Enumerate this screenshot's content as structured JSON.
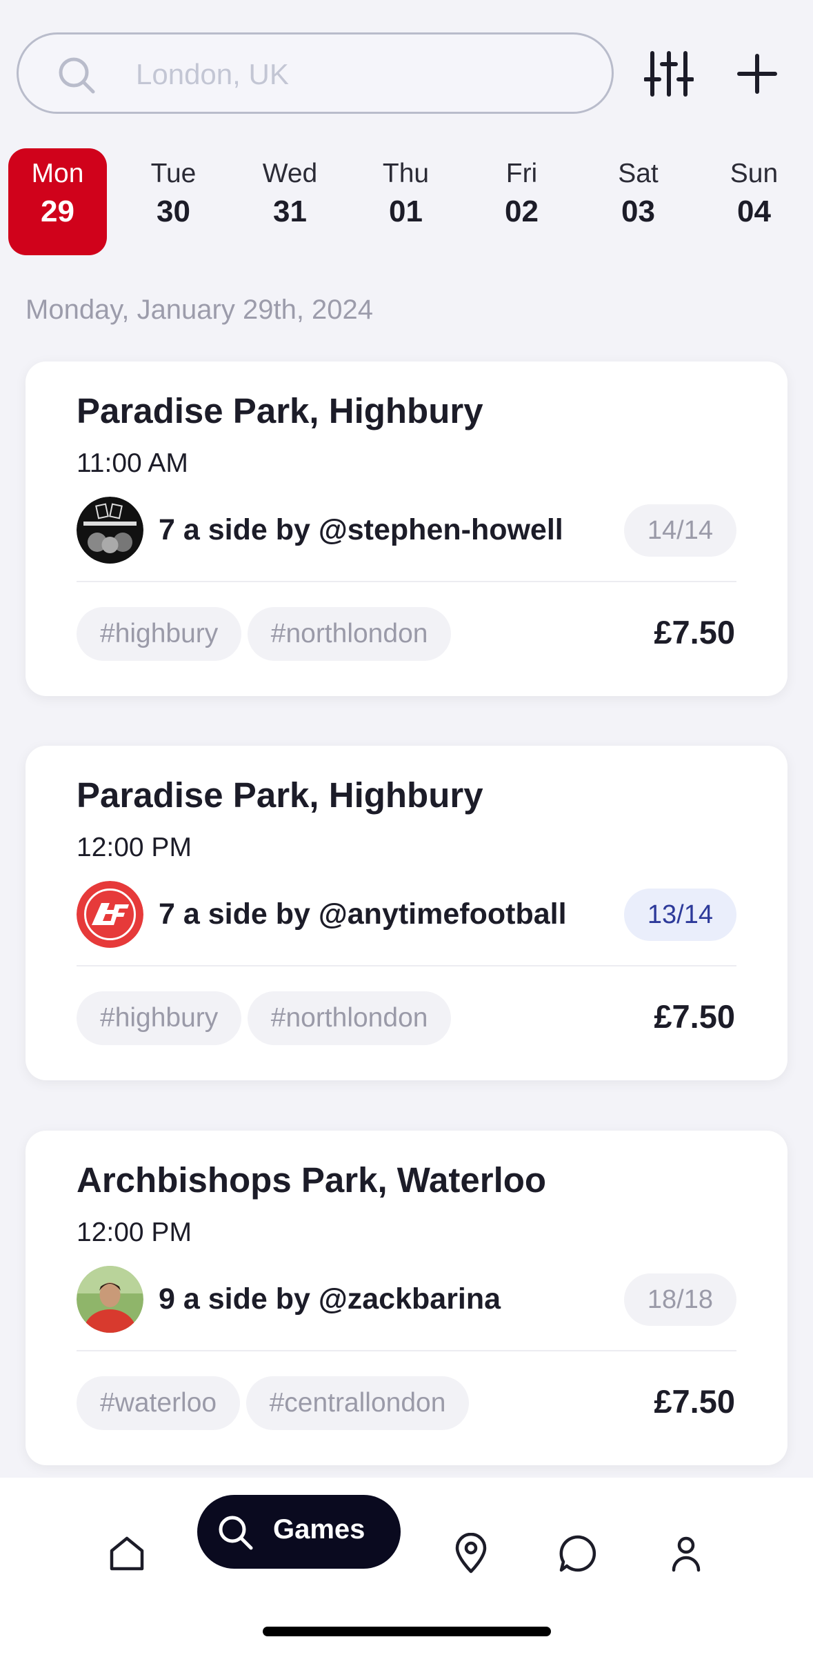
{
  "search": {
    "placeholder": "London, UK"
  },
  "toolbar": {
    "filter_icon": "sliders-icon",
    "add_icon": "plus-icon"
  },
  "days": [
    {
      "name": "Mon",
      "num": "29",
      "active": true
    },
    {
      "name": "Tue",
      "num": "30",
      "active": false
    },
    {
      "name": "Wed",
      "num": "31",
      "active": false
    },
    {
      "name": "Thu",
      "num": "01",
      "active": false
    },
    {
      "name": "Fri",
      "num": "02",
      "active": false
    },
    {
      "name": "Sat",
      "num": "03",
      "active": false
    },
    {
      "name": "Sun",
      "num": "04",
      "active": false
    }
  ],
  "date_heading": "Monday, January 29th, 2024",
  "games": [
    {
      "venue": "Paradise Park, Highbury",
      "time": "11:00 AM",
      "organiser": "7 a side by @stephen-howell",
      "slots": "14/14",
      "tags": [
        "#highbury",
        "#northlondon"
      ],
      "price": "£7.50"
    },
    {
      "venue": "Paradise Park, Highbury",
      "time": "12:00 PM",
      "organiser": "7 a side by @anytimefootball",
      "slots": "13/14",
      "tags": [
        "#highbury",
        "#northlondon"
      ],
      "price": "£7.50"
    },
    {
      "venue": "Archbishops Park, Waterloo",
      "time": "12:00 PM",
      "organiser": "9 a side by @zackbarina",
      "slots": "18/18",
      "tags": [
        "#waterloo",
        "#centrallondon"
      ],
      "price": "£7.50"
    }
  ],
  "nav": {
    "games_label": "Games"
  },
  "colors": {
    "accent": "#d0021b",
    "nav_active": "#0a0a1f",
    "open_slots": "#2d3a9a"
  }
}
